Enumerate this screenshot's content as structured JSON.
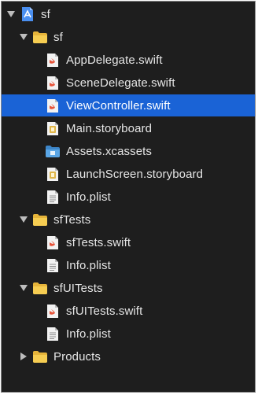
{
  "navigator": {
    "project": {
      "label": "sf"
    },
    "groups": [
      {
        "label": "sf",
        "files": [
          {
            "label": "AppDelegate.swift",
            "icon": "swift-file-icon"
          },
          {
            "label": "SceneDelegate.swift",
            "icon": "swift-file-icon"
          },
          {
            "label": "ViewController.swift",
            "icon": "swift-file-icon",
            "selected": true
          },
          {
            "label": "Main.storyboard",
            "icon": "storyboard-file-icon"
          },
          {
            "label": "Assets.xcassets",
            "icon": "asset-catalog-icon"
          },
          {
            "label": "LaunchScreen.storyboard",
            "icon": "storyboard-file-icon"
          },
          {
            "label": "Info.plist",
            "icon": "plist-file-icon"
          }
        ]
      },
      {
        "label": "sfTests",
        "files": [
          {
            "label": "sfTests.swift",
            "icon": "swift-file-icon"
          },
          {
            "label": "Info.plist",
            "icon": "plist-file-icon"
          }
        ]
      },
      {
        "label": "sfUITests",
        "files": [
          {
            "label": "sfUITests.swift",
            "icon": "swift-file-icon"
          },
          {
            "label": "Info.plist",
            "icon": "plist-file-icon"
          }
        ]
      },
      {
        "label": "Products",
        "collapsed": true
      }
    ]
  },
  "colors": {
    "background": "#1e1e1e",
    "selection": "#1a63d6",
    "text": "#e6e6e6",
    "folder": "#f2c94c",
    "swift": "#e8543a"
  }
}
